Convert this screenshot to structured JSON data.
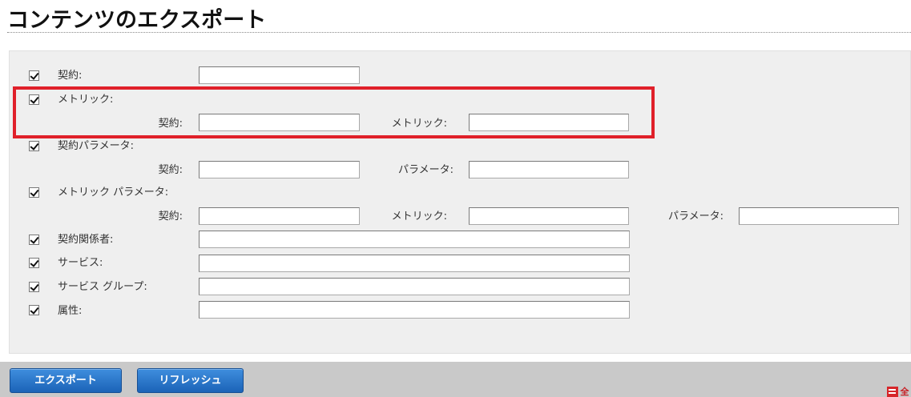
{
  "page": {
    "title": "コンテンツのエクスポート"
  },
  "rows": {
    "contract": {
      "label": "契約:",
      "checked": true
    },
    "metric": {
      "label": "メトリック:",
      "checked": true,
      "sub": {
        "contract_label": "契約:",
        "metric_label": "メトリック:"
      }
    },
    "contract_param": {
      "label": "契約パラメータ:",
      "checked": true,
      "sub": {
        "contract_label": "契約:",
        "param_label": "パラメータ:"
      }
    },
    "metric_param": {
      "label": "メトリック パラメータ:",
      "checked": true,
      "sub": {
        "contract_label": "契約:",
        "metric_label": "メトリック:",
        "param_label": "パラメータ:"
      }
    },
    "stakeholder": {
      "label": "契約関係者:",
      "checked": true
    },
    "service": {
      "label": "サービス:",
      "checked": true
    },
    "service_group": {
      "label": "サービス グループ:",
      "checked": true
    },
    "attribute": {
      "label": "属性:",
      "checked": true
    }
  },
  "buttons": {
    "export": "エクスポート",
    "refresh": "リフレッシュ"
  },
  "corner": {
    "glyph": "全"
  },
  "colors": {
    "highlight": "#e0202a",
    "button": "#2b78cc",
    "panel": "#efefef",
    "bottom_bar": "#c9c9c9"
  },
  "icons": {
    "checkbox": "checkmark-icon",
    "corner_left": "flag-icon"
  }
}
